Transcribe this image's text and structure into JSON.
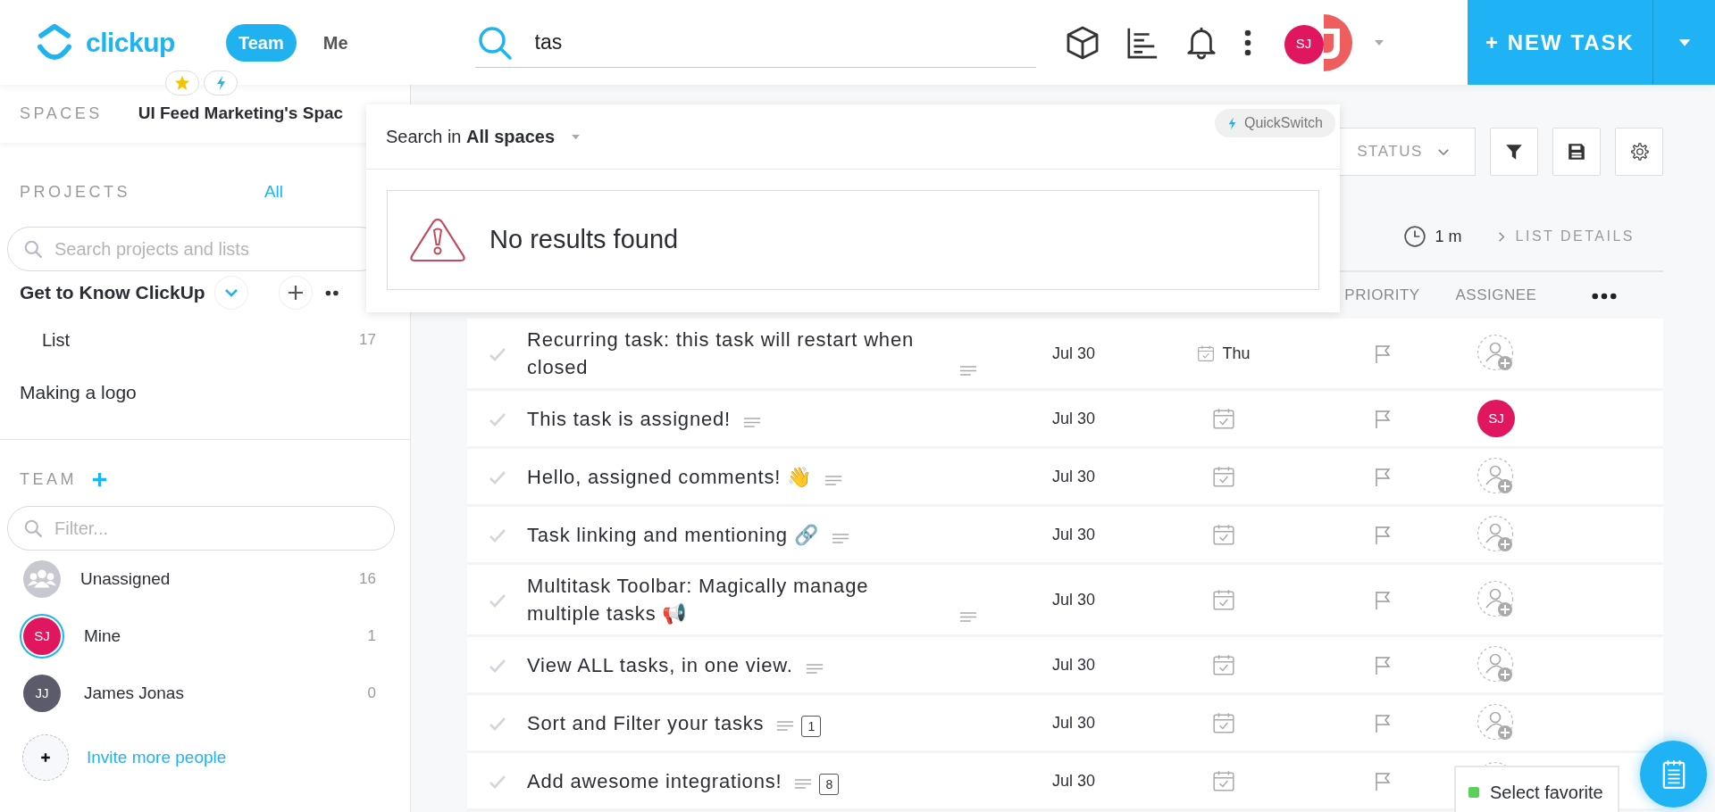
{
  "topbar": {
    "logo": "clickup",
    "tabs": [
      {
        "label": "Team",
        "selected": true
      },
      {
        "label": "Me",
        "selected": false
      }
    ],
    "search": {
      "value": "tas"
    },
    "user": {
      "initials": "SJ",
      "color": "#e0175f"
    },
    "new_task": "+ NEW TASK"
  },
  "sidebar": {
    "spaces_label": "SPACES",
    "space_name": "UI Feed Marketing's Spac",
    "projects": {
      "heading": "PROJECTS",
      "all_link": "All",
      "search_placeholder": "Search projects and lists",
      "items": [
        {
          "name": "Get to Know ClickUp",
          "expanded": true,
          "children": [
            {
              "name": "List",
              "count": "17"
            }
          ]
        },
        {
          "name": "Making a logo"
        }
      ]
    },
    "team": {
      "heading": "TEAM",
      "filter_placeholder": "Filter...",
      "members": [
        {
          "kind": "group",
          "name": "Unassigned",
          "count": "16",
          "selected": false
        },
        {
          "kind": "person",
          "initials": "SJ",
          "name": "Mine",
          "count": "1",
          "selected": true,
          "color": "#e0175f"
        },
        {
          "kind": "person",
          "initials": "JJ",
          "name": "James Jonas",
          "count": "0",
          "selected": false,
          "color": "#5b5b6b"
        }
      ],
      "invite": "Invite more people"
    }
  },
  "search_dropdown": {
    "quickswitch": "QuickSwitch",
    "scope_label": "Search in **All spaces**",
    "message": "No results found"
  },
  "toolbar": {
    "status": "STATUS",
    "time": "1 m",
    "list_details": "LIST DETAILS"
  },
  "table": {
    "columns": [
      "PRIORITY",
      "ASSIGNEE"
    ],
    "rows": [
      {
        "title": "Recurring task: this task will restart when closed",
        "date": "Jul 30",
        "due": "Thu"
      },
      {
        "title": "This task is assigned!",
        "date": "Jul 30",
        "assignee": {
          "initials": "SJ",
          "color": "#e0175f"
        }
      },
      {
        "title": "Hello, assigned comments! 👋",
        "date": "Jul 30"
      },
      {
        "title": "Task linking and mentioning 🔗",
        "date": "Jul 30"
      },
      {
        "title": "Multitask Toolbar: Magically manage multiple tasks 📢",
        "date": "Jul 30"
      },
      {
        "title": "View ALL tasks, in one view.",
        "date": "Jul 30"
      },
      {
        "title": "Sort and Filter your tasks",
        "date": "Jul 30",
        "count": "1"
      },
      {
        "title": "Add awesome integrations!",
        "date": "Jul 30",
        "count": "8"
      }
    ]
  },
  "favorites": {
    "label": "Select favorite",
    "color": "#5ad25a"
  }
}
